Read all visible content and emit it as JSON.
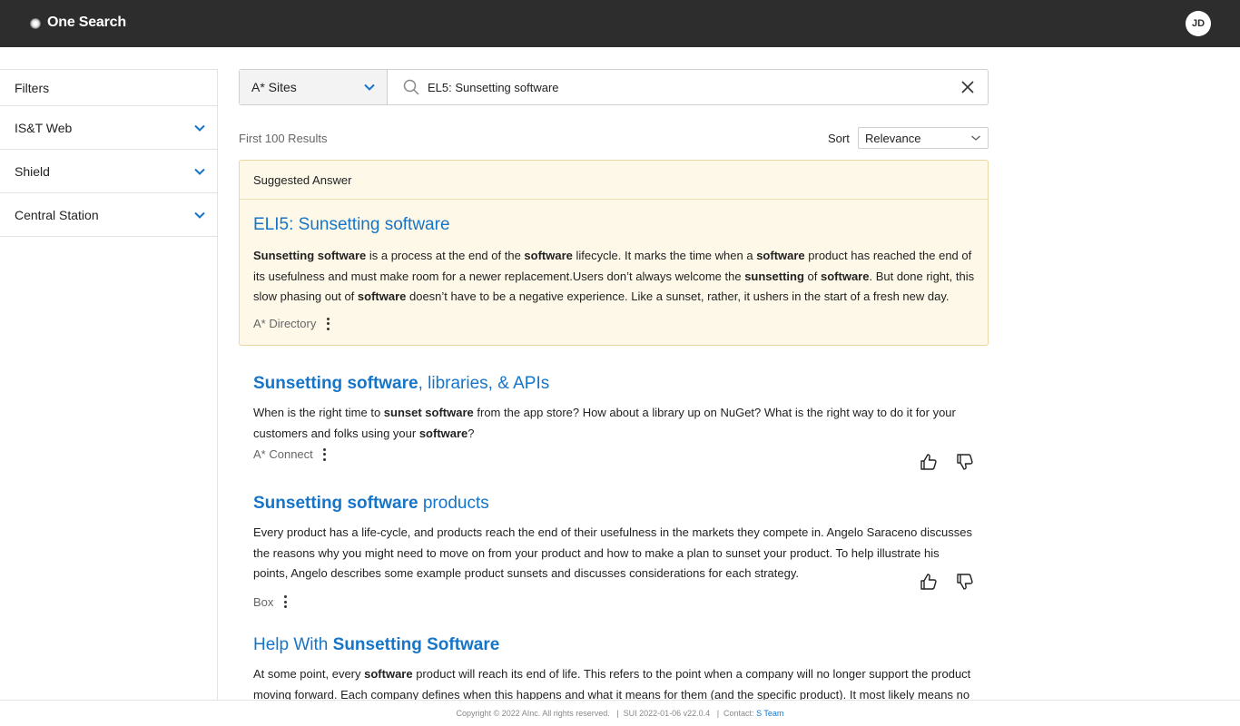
{
  "app": {
    "title": "One Search",
    "avatar_initials": "JD"
  },
  "sidebar": {
    "title": "Filters",
    "items": [
      {
        "label": "IS&T Web"
      },
      {
        "label": "Shield"
      },
      {
        "label": "Central Station"
      }
    ]
  },
  "search": {
    "scope": "A* Sites",
    "query": "EL5: Sunsetting software"
  },
  "results_header": {
    "count_text": "First 100 Results",
    "sort_label": "Sort",
    "sort_value": "Relevance"
  },
  "suggested_answer": {
    "header": "Suggested Answer",
    "title": "ELI5: Sunsetting software",
    "body_parts": [
      {
        "t": "Sunsetting software",
        "b": true
      },
      {
        "t": " is a process at the end of the ",
        "b": false
      },
      {
        "t": "software",
        "b": true
      },
      {
        "t": " lifecycle. It marks the time when a ",
        "b": false
      },
      {
        "t": "software",
        "b": true
      },
      {
        "t": " product has reached the end of its usefulness and must make room for a newer replacement.Users don’t always welcome the ",
        "b": false
      },
      {
        "t": "sunsetting",
        "b": true
      },
      {
        "t": " of ",
        "b": false
      },
      {
        "t": "software",
        "b": true
      },
      {
        "t": ". But done right, this slow phasing out of ",
        "b": false
      },
      {
        "t": "software",
        "b": true
      },
      {
        "t": " doesn’t have to be a negative experience. Like a sunset, rather, it ushers in the start of a fresh new day.",
        "b": false
      }
    ],
    "source": "A* Directory"
  },
  "results": [
    {
      "title_parts": [
        {
          "t": "Sunsetting software",
          "b": true
        },
        {
          "t": ", libraries, & APIs",
          "b": false
        }
      ],
      "body_parts": [
        {
          "t": "When is the right time to ",
          "b": false
        },
        {
          "t": "sunset software",
          "b": true
        },
        {
          "t": " from the app store? How about a library up on NuGet? What is the right way to do it for your customers and folks using your ",
          "b": false
        },
        {
          "t": "software",
          "b": true
        },
        {
          "t": "?",
          "b": false
        }
      ],
      "source": "A* Connect"
    },
    {
      "title_parts": [
        {
          "t": "Sunsetting software",
          "b": true
        },
        {
          "t": " products",
          "b": false
        }
      ],
      "body_parts": [
        {
          "t": "Every product has a life-cycle, and products reach the end of their usefulness in the markets they compete in. Angelo Saraceno discusses the reasons why you might need to move on from your product and how to make a plan to sunset your product. To help illustrate his points, Angelo describes some example product sunsets and discusses considerations for each strategy.",
          "b": false
        }
      ],
      "source": "Box"
    },
    {
      "title_parts": [
        {
          "t": "Help With ",
          "b": false
        },
        {
          "t": "Sunsetting Software",
          "b": true
        }
      ],
      "body_parts": [
        {
          "t": "At some point, every ",
          "b": false
        },
        {
          "t": "software",
          "b": true
        },
        {
          "t": " product will reach its end of life. This refers to the point when a company will no longer support the product moving forward. Each company defines when this happens and what it means for them (and the specific product). It most likely means no",
          "b": false
        }
      ],
      "source": ""
    }
  ],
  "footer": {
    "copyright": "Copyright © 2022 AInc. All rights reserved.",
    "version": "SUI 2022-01-06 v22.0.4",
    "contact_label": "Contact:",
    "contact_link": "S Team"
  },
  "colors": {
    "topbar": "#2d2d2d",
    "link": "#1675c8",
    "answer_bg": "#fef8e8"
  },
  "icons": [
    "chevron-down-icon",
    "search-icon",
    "close-icon",
    "thumbs-up-icon",
    "thumbs-down-icon",
    "more-vertical-icon"
  ]
}
